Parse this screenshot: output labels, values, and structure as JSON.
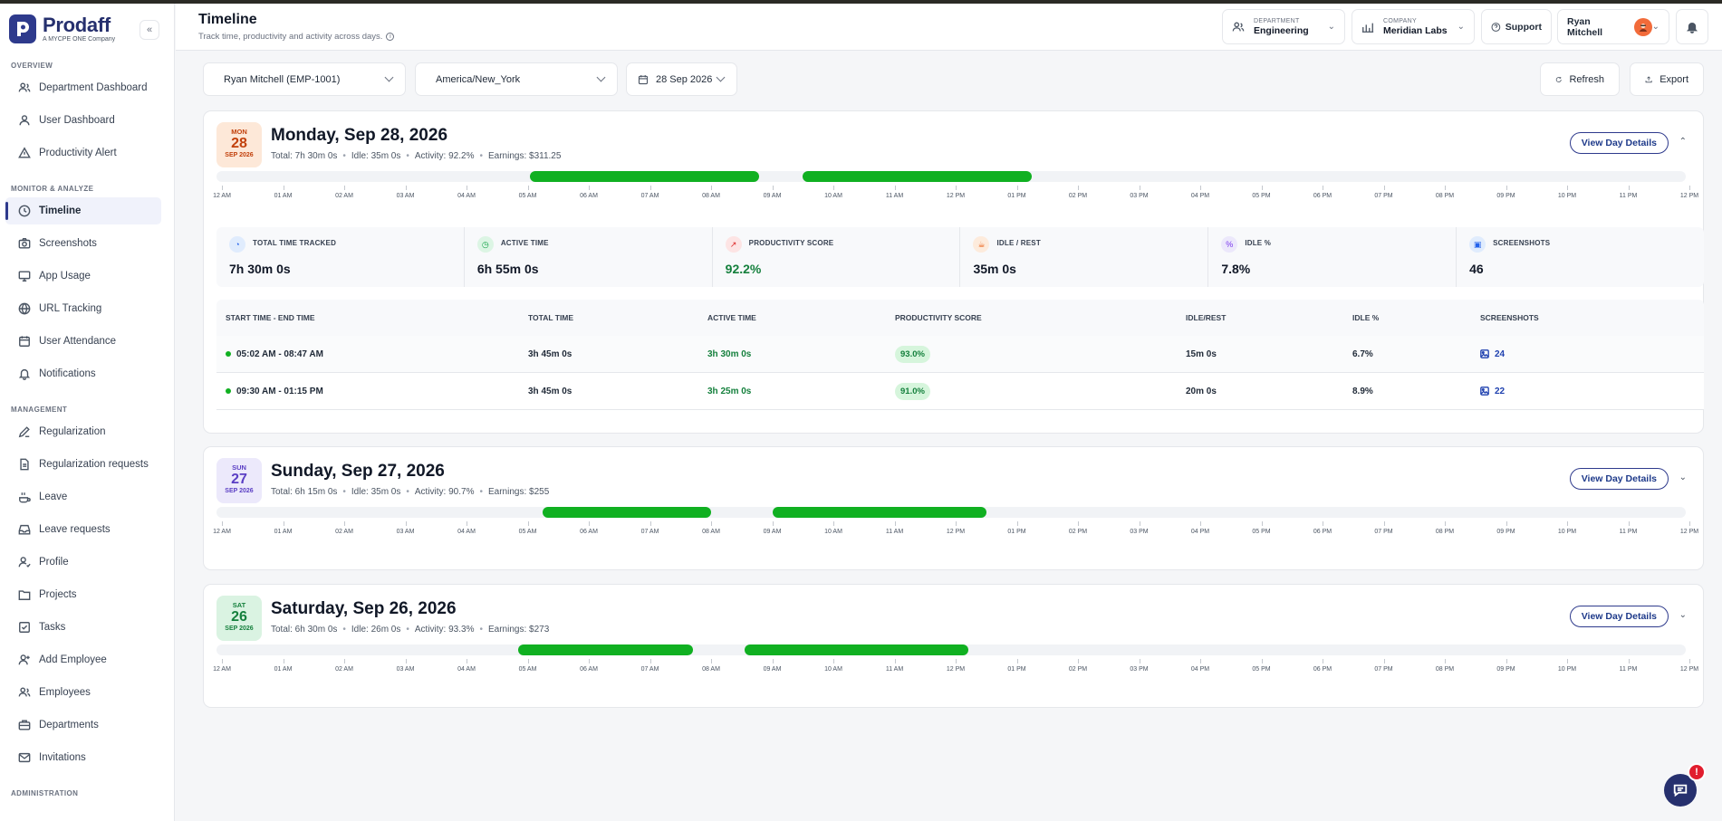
{
  "brand": {
    "name": "Prodaff",
    "sub": "A MYCPE ONE Company",
    "collapse": "«"
  },
  "sidebar": {
    "sections": [
      {
        "title": "OVERVIEW",
        "items": [
          {
            "label": "Department Dashboard",
            "icon": "users-icon"
          },
          {
            "label": "User Dashboard",
            "icon": "user-icon"
          },
          {
            "label": "Productivity Alert",
            "icon": "alert-icon"
          }
        ]
      },
      {
        "title": "MONITOR & ANALYZE",
        "items": [
          {
            "label": "Timeline",
            "icon": "clock-icon"
          },
          {
            "label": "Screenshots",
            "icon": "camera-icon"
          },
          {
            "label": "App Usage",
            "icon": "monitor-icon"
          },
          {
            "label": "URL Tracking",
            "icon": "globe-icon"
          },
          {
            "label": "User Attendance",
            "icon": "calendar-icon"
          },
          {
            "label": "Notifications",
            "icon": "bell-icon"
          }
        ]
      },
      {
        "title": "MANAGEMENT",
        "items": [
          {
            "label": "Regularization",
            "icon": "pen-icon"
          },
          {
            "label": "Regularization requests",
            "icon": "file-icon"
          },
          {
            "label": "Leave",
            "icon": "leave-icon"
          },
          {
            "label": "Leave requests",
            "icon": "inbox-icon"
          },
          {
            "label": "Profile",
            "icon": "profile-icon"
          },
          {
            "label": "Projects",
            "icon": "folder-icon"
          },
          {
            "label": "Tasks",
            "icon": "task-icon"
          },
          {
            "label": "Add Employee",
            "icon": "user-plus-icon"
          },
          {
            "label": "Employees",
            "icon": "users-icon"
          },
          {
            "label": "Departments",
            "icon": "briefcase-icon"
          },
          {
            "label": "Invitations",
            "icon": "mail-icon"
          }
        ]
      },
      {
        "title": "ADMINISTRATION",
        "items": []
      }
    ],
    "active": "Timeline"
  },
  "header": {
    "title": "Timeline",
    "subtitle": "Track time, productivity and activity across days.",
    "department_label": "DEPARTMENT",
    "department_value": "Engineering",
    "company_label": "COMPANY",
    "company_value": "Meridian Labs",
    "support": "Support",
    "user": "Ryan Mitchell"
  },
  "filters": {
    "employee": "Ryan Mitchell (EMP-1001)",
    "timezone": "America/New_York",
    "date": "28 Sep 2026",
    "refresh": "Refresh",
    "export": "Export"
  },
  "view_details_label": "View Day Details",
  "hour_labels": [
    "12 AM",
    "01 AM",
    "02 AM",
    "03 AM",
    "04 AM",
    "05 AM",
    "06 AM",
    "07 AM",
    "08 AM",
    "09 AM",
    "10 AM",
    "11 AM",
    "12 PM",
    "01 PM",
    "02 PM",
    "03 PM",
    "04 PM",
    "05 PM",
    "06 PM",
    "07 PM",
    "08 PM",
    "09 PM",
    "10 PM",
    "11 PM",
    "12 PM"
  ],
  "days": [
    {
      "dow": "MON",
      "day": "28",
      "month_year": "SEP 2026",
      "title": "Monday, Sep 28, 2026",
      "total": "Total: 7h 30m 0s",
      "idle": "Idle: 35m 0s",
      "activity": "Activity: 92.2%",
      "earnings": "Earnings: $311.25",
      "expanded": true,
      "toggle": "⌃",
      "sessions_hours": [
        [
          5.03,
          8.78
        ],
        [
          9.5,
          13.25
        ]
      ],
      "metrics": [
        {
          "label": "TOTAL TIME TRACKED",
          "value": "7h 30m 0s"
        },
        {
          "label": "ACTIVE TIME",
          "value": "6h 55m 0s"
        },
        {
          "label": "PRODUCTIVITY SCORE",
          "value": "92.2%"
        },
        {
          "label": "IDLE / REST",
          "value": "35m 0s"
        },
        {
          "label": "IDLE %",
          "value": "7.8%"
        },
        {
          "label": "SCREENSHOTS",
          "value": "46"
        }
      ],
      "table_headers": [
        "START TIME - END TIME",
        "TOTAL TIME",
        "ACTIVE TIME",
        "PRODUCTIVITY SCORE",
        "IDLE/REST",
        "IDLE %",
        "SCREENSHOTS"
      ],
      "rows": [
        {
          "range": "05:02 AM - 08:47 AM",
          "total": "3h 45m 0s",
          "active": "3h 30m 0s",
          "score": "93.0%",
          "idle": "15m 0s",
          "idle_pct": "6.7%",
          "shots": "24"
        },
        {
          "range": "09:30 AM - 01:15 PM",
          "total": "3h 45m 0s",
          "active": "3h 25m 0s",
          "score": "91.0%",
          "idle": "20m 0s",
          "idle_pct": "8.9%",
          "shots": "22"
        }
      ]
    },
    {
      "dow": "SUN",
      "day": "27",
      "month_year": "SEP 2026",
      "title": "Sunday, Sep 27, 2026",
      "total": "Total: 6h 15m 0s",
      "idle": "Idle: 35m 0s",
      "activity": "Activity: 90.7%",
      "earnings": "Earnings: $255",
      "expanded": false,
      "toggle": "⌄",
      "sessions_hours": [
        [
          5.25,
          8.0
        ],
        [
          9.0,
          12.5
        ]
      ]
    },
    {
      "dow": "SAT",
      "day": "26",
      "month_year": "SEP 2026",
      "title": "Saturday, Sep 26, 2026",
      "total": "Total: 6h 30m 0s",
      "idle": "Idle: 26m 0s",
      "activity": "Activity: 93.3%",
      "earnings": "Earnings: $273",
      "expanded": false,
      "toggle": "⌄",
      "sessions_hours": [
        [
          4.85,
          7.7
        ],
        [
          8.55,
          12.2
        ]
      ]
    }
  ],
  "chat_badge": "!"
}
